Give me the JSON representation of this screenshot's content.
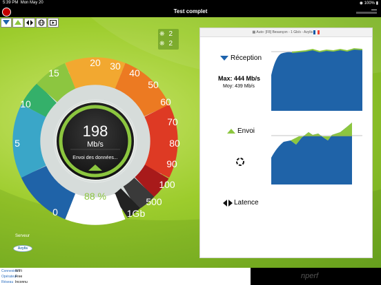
{
  "status_bar": {
    "time": "5:39 PM",
    "date": "Mon May 20",
    "battery": "100%"
  },
  "title": "Test complet",
  "toolbar": [
    "download-icon",
    "upload-icon",
    "latency-icon",
    "globe-icon",
    "video-icon"
  ],
  "servers": [
    {
      "icon": "network-icon",
      "count": "2"
    },
    {
      "icon": "network-icon",
      "count": "2"
    }
  ],
  "gauge": {
    "ticks": [
      "0",
      "5",
      "10",
      "15",
      "20",
      "30",
      "40",
      "50",
      "60",
      "70",
      "80",
      "90",
      "100",
      "500",
      "1Gb"
    ],
    "value": "198",
    "unit": "Mb/s",
    "status": "Envoi des données...",
    "progress": "88 %"
  },
  "results": {
    "header": "Auto: [F8] Besançon - 1 Gb/s - Azylis",
    "reception": {
      "label": "Réception",
      "max": "Max: 444 Mb/s",
      "avg": "Moy: 439 Mb/s"
    },
    "envoi": {
      "label": "Envoi"
    },
    "latence": {
      "label": "Latence"
    }
  },
  "server_label": "Serveur",
  "server_logo_text": "Azylis",
  "connection": [
    {
      "key": "Connexion",
      "value": "WiFi"
    },
    {
      "key": "Opérateur",
      "value": "Free"
    },
    {
      "key": "Réseau",
      "value": "Inconnu"
    }
  ],
  "brand": "nperf",
  "colors": {
    "accent": "#8cc63f",
    "download": "#1d63ad",
    "upload": "#8cc63f"
  }
}
